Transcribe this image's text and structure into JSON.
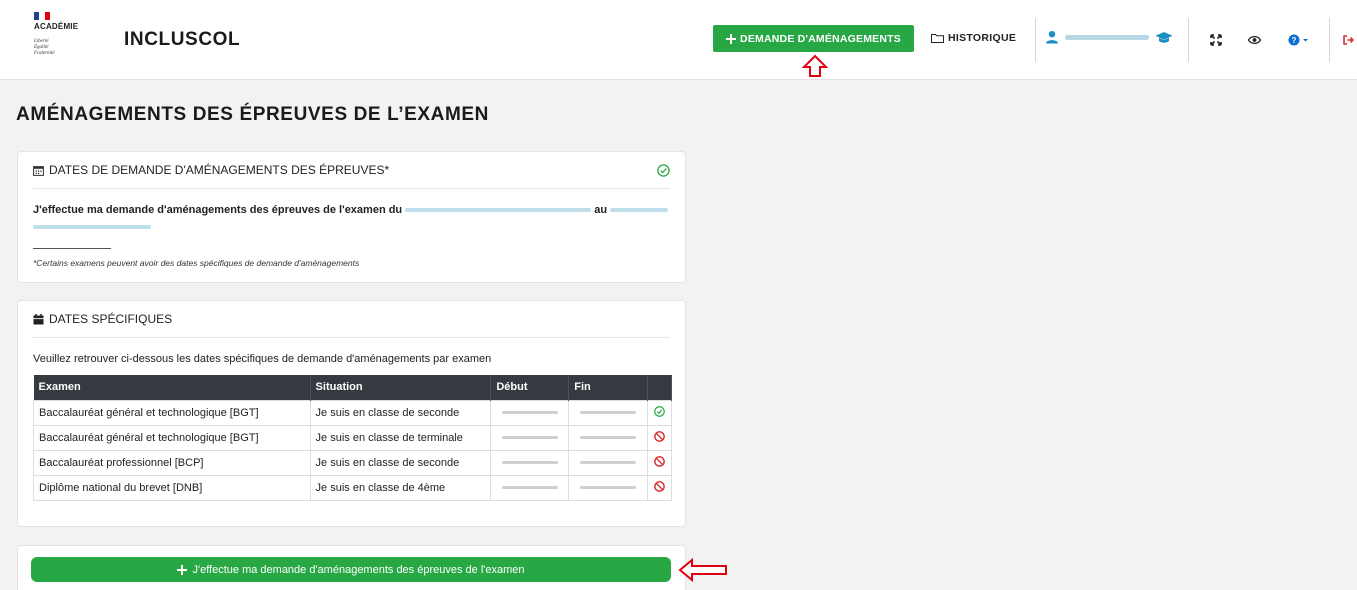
{
  "header": {
    "logo_text": "ACADÉMIE",
    "motto": [
      "Liberté",
      "Égalité",
      "Fraternité"
    ],
    "app_title": "INCLUSCOL",
    "btn_demande": "DEMANDE D'AMÉNAGEMENTS",
    "nav_historique": "HISTORIQUE"
  },
  "page_title": "AMÉNAGEMENTS DES ÉPREUVES DE L’EXAMEN",
  "card_dates": {
    "title": "DATES DE DEMANDE D'AMÉNAGEMENTS DES ÉPREUVES*",
    "text_prefix": "J'effectue ma demande d'aménagements des épreuves de l'examen du",
    "text_middle": "au",
    "footnote": "*Certains examens peuvent avoir des dates spécifiques de demande d'aménagements"
  },
  "card_specific": {
    "title": "DATES SPÉCIFIQUES",
    "intro": "Veuillez retrouver ci-dessous les dates spécifiques de demande d'aménagements par examen",
    "columns": [
      "Examen",
      "Situation",
      "Début",
      "Fin"
    ],
    "rows": [
      {
        "examen": "Baccalauréat général et technologique [BGT]",
        "situation": "Je suis en classe de seconde",
        "status": "ok"
      },
      {
        "examen": "Baccalauréat général et technologique [BGT]",
        "situation": "Je suis en classe de terminale",
        "status": "blocked"
      },
      {
        "examen": "Baccalauréat professionnel [BCP]",
        "situation": "Je suis en classe de seconde",
        "status": "blocked"
      },
      {
        "examen": "Diplôme national du brevet [DNB]",
        "situation": "Je suis en classe de 4ème",
        "status": "blocked"
      }
    ]
  },
  "submit_button": "J'effectue ma demande d'aménagements des épreuves de l'examen",
  "colors": {
    "green": "#27a844",
    "dark_header": "#353a40",
    "blue_accent": "#0a6fd1",
    "red": "#dc2626"
  },
  "icons": [
    "plus-icon",
    "folder-icon",
    "user-avatar-icon",
    "graduation-cap-icon",
    "expand-icon",
    "eye-icon",
    "help-icon",
    "logout-icon",
    "calendar-icon",
    "check-circle-icon",
    "ban-icon",
    "arrow-annotation"
  ]
}
